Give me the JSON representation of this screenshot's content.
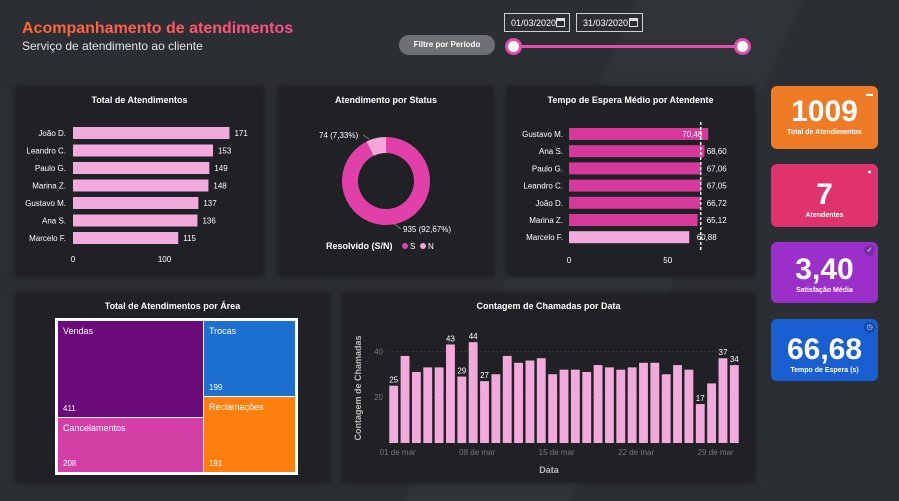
{
  "header": {
    "title": "Acompanhamento de atendimentos",
    "subtitle": "Serviço de atendimento ao cliente",
    "date_from": "01/03/2020",
    "date_to": "31/03/2020",
    "filter_label": "Filtre por Período"
  },
  "kpis": [
    {
      "value": "1009",
      "label": "Total de Atendimentos",
      "color": "#f07b26",
      "icon": "chat-icon"
    },
    {
      "value": "7",
      "label": "Atendentes",
      "color": "#e0336e",
      "icon": "users-icon"
    },
    {
      "value": "3,40",
      "label": "Satisfação Média",
      "color": "#9b2fc9",
      "icon": "check-icon"
    },
    {
      "value": "66,68",
      "label": "Tempo de Espera (s)",
      "color": "#1a5fd1",
      "icon": "clock-icon"
    }
  ],
  "chart_data": [
    {
      "type": "bar",
      "orientation": "horizontal",
      "title": "Total de Atendimentos",
      "categories": [
        "João D.",
        "Leandro C.",
        "Paulo G.",
        "Marina Z.",
        "Gustavo M.",
        "Ana S.",
        "Marcelo F."
      ],
      "values": [
        171,
        153,
        149,
        148,
        137,
        136,
        115
      ],
      "labels": [
        "171",
        "153",
        "149",
        "148",
        "137",
        "136",
        "115"
      ],
      "xticks": [
        "0",
        "100"
      ],
      "xlim": [
        0,
        190
      ],
      "color": "#f2a9dc"
    },
    {
      "type": "pie",
      "title": "Atendimento por Status",
      "legend_title": "Resolvido (S/N)",
      "slices": [
        {
          "name": "S",
          "value": 935,
          "label": "935 (92,67%)",
          "color": "#e040a8"
        },
        {
          "name": "N",
          "value": 74,
          "label": "74 (7,33%)",
          "color": "#f4a6d6"
        }
      ]
    },
    {
      "type": "bar",
      "orientation": "horizontal",
      "title": "Tempo de Espera Médio por Atendente",
      "categories": [
        "Gustavo M.",
        "Ana S.",
        "Paulo G.",
        "Leandro C.",
        "João D.",
        "Marina Z.",
        "Marcelo F."
      ],
      "values": [
        70.48,
        68.6,
        67.06,
        67.05,
        66.72,
        65.12,
        60.88
      ],
      "labels": [
        "70,48",
        "68,60",
        "67,06",
        "67,05",
        "66,72",
        "65,12",
        "60,88"
      ],
      "reference_line": 66.68,
      "xticks": [
        "0",
        "50"
      ],
      "xlim": [
        0,
        80
      ]
    },
    {
      "type": "treemap",
      "title": "Total de Atendimentos por Área",
      "items": [
        {
          "name": "Vendas",
          "value": 411,
          "label": "411",
          "color": "#6b0a7a"
        },
        {
          "name": "Trocas",
          "value": 199,
          "label": "199",
          "color": "#1d6fd0"
        },
        {
          "name": "Cancelamentos",
          "value": 208,
          "label": "208",
          "color": "#d43fa6"
        },
        {
          "name": "Reclamações",
          "value": 191,
          "label": "191",
          "color": "#ff7f0e"
        }
      ]
    },
    {
      "type": "bar",
      "title": "Contagem de Chamadas por Data",
      "xlabel": "Data",
      "ylabel": "Contagem de Chamadas",
      "x": [
        "01/03",
        "02/03",
        "03/03",
        "04/03",
        "05/03",
        "06/03",
        "07/03",
        "08/03",
        "09/03",
        "10/03",
        "11/03",
        "12/03",
        "13/03",
        "14/03",
        "15/03",
        "16/03",
        "17/03",
        "18/03",
        "19/03",
        "20/03",
        "21/03",
        "22/03",
        "23/03",
        "24/03",
        "25/03",
        "26/03",
        "27/03",
        "28/03",
        "29/03",
        "30/03",
        "31/03"
      ],
      "values": [
        25,
        38,
        31,
        33,
        33,
        43,
        29,
        44,
        27,
        30,
        38,
        35,
        36,
        37,
        30,
        32,
        32,
        31,
        34,
        33,
        32,
        33,
        35,
        35,
        30,
        34,
        32,
        17,
        26,
        37,
        34
      ],
      "data_labels": {
        "0": "25",
        "5": "43",
        "6": "29",
        "7": "44",
        "8": "27",
        "27": "17",
        "29": "37",
        "30": "34"
      },
      "xticks": [
        "01 de mar",
        "08 de mar",
        "15 de mar",
        "22 de mar",
        "29 de mar"
      ],
      "yticks": [
        "20",
        "40"
      ],
      "ylim": [
        0,
        48
      ],
      "color": "#f2a9dc"
    }
  ]
}
